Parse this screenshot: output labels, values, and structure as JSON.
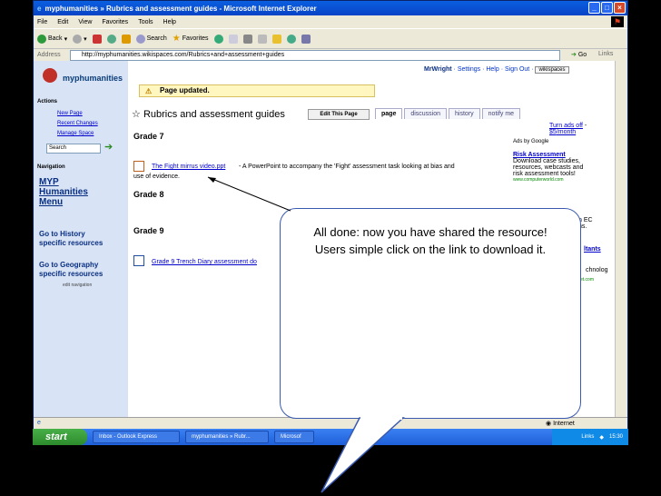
{
  "window": {
    "title": "myphumanities » Rubrics and assessment guides - Microsoft Internet Explorer"
  },
  "menu": [
    "File",
    "Edit",
    "View",
    "Favorites",
    "Tools",
    "Help"
  ],
  "toolbar": {
    "back": "Back",
    "search": "Search",
    "favorites": "Favorites"
  },
  "address": {
    "label": "Address",
    "url": "http://myphumanities.wikispaces.com/Rubrics+and+assessment+guides",
    "go": "Go",
    "links": "Links"
  },
  "site": {
    "brand": "myphumanities",
    "user": "MrWright",
    "settings": "Settings",
    "help": "Help",
    "signout": "Sign Out",
    "wikispaces": "wikispaces"
  },
  "notice": "Page updated.",
  "sidebar": {
    "actions_heading": "Actions",
    "actions": [
      "New Page",
      "Recent Changes",
      "Manage Space"
    ],
    "search_value": "Search",
    "nav_heading": "Navigation",
    "nav_big": [
      "MYP",
      "Humanities",
      "Menu"
    ],
    "nav_history": [
      "Go to History",
      "specific resources"
    ],
    "nav_geo": [
      "Go to Geography",
      "specific resources"
    ],
    "edit_nav": "edit navigation"
  },
  "page": {
    "title": "Rubrics and assessment guides",
    "edit_button": "Edit This Page",
    "tabs": [
      "page",
      "discussion",
      "history",
      "notify me"
    ]
  },
  "content": {
    "grade7": "Grade 7",
    "file7_link": "The Fight mirrus video.ppt",
    "file7_desc": "- A PowerPoint to accompany the 'Fight' assessment task looking at bias and",
    "file7_desc2": "use of evidence.",
    "grade8": "Grade 8",
    "grade9": "Grade 9",
    "file9_link": "Grade 9 Trench Diary assessment do"
  },
  "ads": {
    "turn_off": "Turn ads off",
    "price": "$5",
    "per": "/month",
    "ads_by": "Ads by Google",
    "ad_title": "Risk Assessment",
    "ad_text": [
      "Download case studies,",
      "resources, webcasts and",
      "risk assessment tools!"
    ],
    "ad_url": "www.computerworld.com",
    "frag_ec": "n EC",
    "frag_ns": "ns.",
    "frag_ultants": "ltants",
    "frag_technol": "chnolog",
    "frag_com": "et.com"
  },
  "status": {
    "zone": "Internet"
  },
  "taskbar": {
    "start": "start",
    "tasks": [
      "Inbox - Outlook Express",
      "myphumanities » Rubr...",
      "Microsof"
    ],
    "links": "Links",
    "time": "15:30"
  },
  "callout": {
    "text": "All done: now you have shared the resource! Users simple click on the link to download it."
  }
}
